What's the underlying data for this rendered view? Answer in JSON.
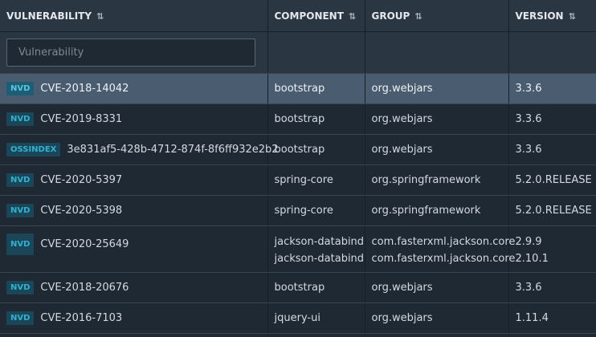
{
  "headers": {
    "vulnerability": "VULNERABILITY",
    "component": "COMPONENT",
    "group": "GROUP",
    "version": "VERSION",
    "sort_glyph": "⇅"
  },
  "filter": {
    "placeholder": "Vulnerability",
    "value": ""
  },
  "rows": [
    {
      "source": "NVD",
      "id": "CVE-2018-14042",
      "components": [
        "bootstrap"
      ],
      "groups": [
        "org.webjars"
      ],
      "versions": [
        "3.3.6"
      ],
      "selected": true
    },
    {
      "source": "NVD",
      "id": "CVE-2019-8331",
      "components": [
        "bootstrap"
      ],
      "groups": [
        "org.webjars"
      ],
      "versions": [
        "3.3.6"
      ]
    },
    {
      "source": "OSSINDEX",
      "id": "3e831af5-428b-4712-874f-8f6ff932e2b2",
      "components": [
        "bootstrap"
      ],
      "groups": [
        "org.webjars"
      ],
      "versions": [
        "3.3.6"
      ]
    },
    {
      "source": "NVD",
      "id": "CVE-2020-5397",
      "components": [
        "spring-core"
      ],
      "groups": [
        "org.springframework"
      ],
      "versions": [
        "5.2.0.RELEASE"
      ]
    },
    {
      "source": "NVD",
      "id": "CVE-2020-5398",
      "components": [
        "spring-core"
      ],
      "groups": [
        "org.springframework"
      ],
      "versions": [
        "5.2.0.RELEASE"
      ]
    },
    {
      "source": "NVD",
      "id": "CVE-2020-25649",
      "components": [
        "jackson-databind",
        "jackson-databind"
      ],
      "groups": [
        "com.fasterxml.jackson.core",
        "com.fasterxml.jackson.core"
      ],
      "versions": [
        "2.9.9",
        "2.10.1"
      ]
    },
    {
      "source": "NVD",
      "id": "CVE-2018-20676",
      "components": [
        "bootstrap"
      ],
      "groups": [
        "org.webjars"
      ],
      "versions": [
        "3.3.6"
      ]
    },
    {
      "source": "NVD",
      "id": "CVE-2016-7103",
      "components": [
        "jquery-ui"
      ],
      "groups": [
        "org.webjars"
      ],
      "versions": [
        "1.11.4"
      ]
    }
  ]
}
